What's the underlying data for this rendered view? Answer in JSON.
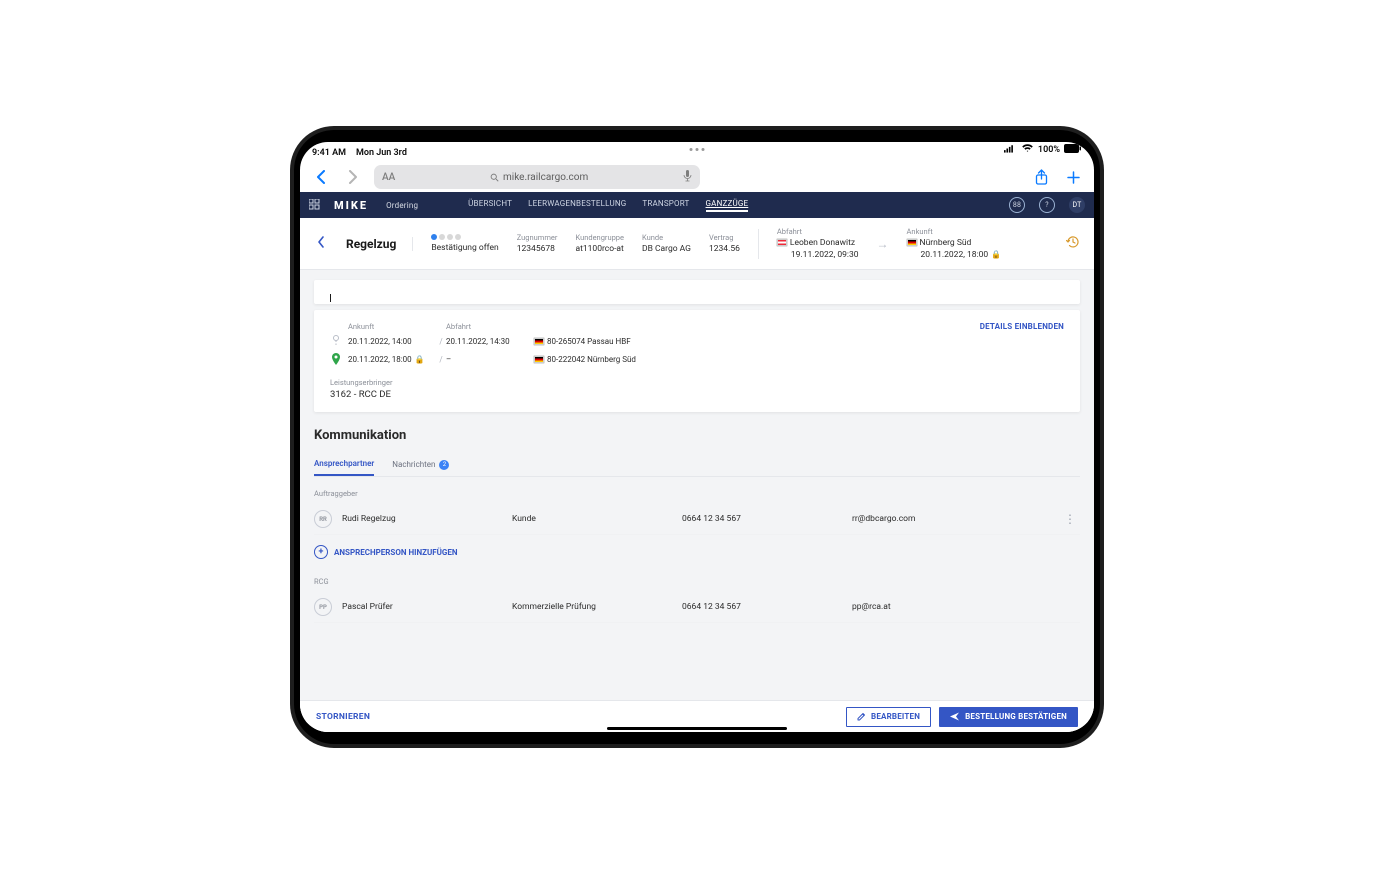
{
  "device": {
    "time": "9:41 AM",
    "date": "Mon Jun 3rd",
    "battery": "100%"
  },
  "browser": {
    "url": "mike.railcargo.com",
    "aa": "AA"
  },
  "nav": {
    "logo": "MIKE",
    "subtitle": "Ordering",
    "tabs": [
      "ÜBERSICHT",
      "LEERWAGENBESTELLUNG",
      "TRANSPORT",
      "GANZZÜGE"
    ],
    "active": 3,
    "avatar": "DT",
    "currency": "88"
  },
  "header": {
    "title": "Regelzug",
    "status": {
      "label": "Bestätigung offen"
    },
    "cols": [
      {
        "lbl": "Zugnummer",
        "val": "12345678"
      },
      {
        "lbl": "Kundengruppe",
        "val": "at1100rco-at"
      },
      {
        "lbl": "Kunde",
        "val": "DB Cargo AG"
      },
      {
        "lbl": "Vertrag",
        "val": "1234.56"
      }
    ],
    "dep": {
      "lbl": "Abfahrt",
      "station": "Leoben Donawitz",
      "ts": "19.11.2022, 09:30",
      "flag": "at"
    },
    "arr": {
      "lbl": "Ankunft",
      "station": "Nürnberg Süd",
      "ts": "20.11.2022, 18:00",
      "flag": "de",
      "locked": true
    }
  },
  "route": {
    "details_link": "DETAILS EINBLENDEN",
    "cols": {
      "arr": "Ankunft",
      "dep": "Abfahrt"
    },
    "rows": [
      {
        "arr": "20.11.2022, 14:00",
        "dep": "20.11.2022, 14:30",
        "code": "80-265074 Passau HBF",
        "flag": "de",
        "pin": false
      },
      {
        "arr": "20.11.2022, 18:00",
        "dep": "–",
        "code": "80-222042 Nürnberg Süd",
        "flag": "de",
        "pin": true,
        "locked": true
      }
    ],
    "provider": {
      "lbl": "Leistungserbringer",
      "val": "3162 - RCC DE"
    }
  },
  "comm": {
    "title": "Kommunikation",
    "tabs": [
      {
        "label": "Ansprechpartner"
      },
      {
        "label": "Nachrichten",
        "badge": "2"
      }
    ],
    "group1": "Auftraggeber",
    "contact1": {
      "init": "RR",
      "name": "Rudi Regelzug",
      "role": "Kunde",
      "phone": "0664 12 34 567",
      "email": "rr@dbcargo.com"
    },
    "add": "ANSPRECHPERSON HINZUFÜGEN",
    "group2": "RCG",
    "contact2": {
      "init": "PP",
      "name": "Pascal Prüfer",
      "role": "Kommerzielle Prüfung",
      "phone": "0664 12 34 567",
      "email": "pp@rca.at"
    }
  },
  "footer": {
    "cancel": "STORNIEREN",
    "edit": "BEARBEITEN",
    "confirm": "BESTELLUNG BESTÄTIGEN"
  }
}
